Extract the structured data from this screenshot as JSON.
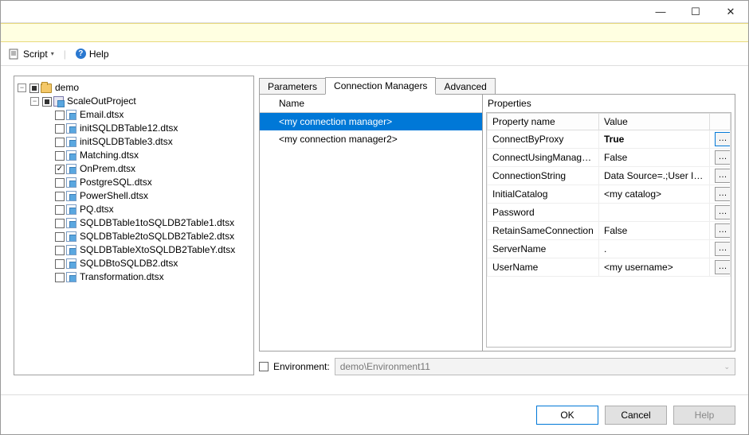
{
  "window": {
    "minimize_glyph": "—",
    "maximize_glyph": "☐",
    "close_glyph": "✕"
  },
  "toolbar": {
    "script_label": "Script",
    "help_label": "Help"
  },
  "tree": {
    "root": "demo",
    "project": "ScaleOutProject",
    "items": [
      "Email.dtsx",
      "initSQLDBTable12.dtsx",
      "initSQLDBTable3.dtsx",
      "Matching.dtsx",
      "OnPrem.dtsx",
      "PostgreSQL.dtsx",
      "PowerShell.dtsx",
      "PQ.dtsx",
      "SQLDBTable1toSQLDB2Table1.dtsx",
      "SQLDBTable2toSQLDB2Table2.dtsx",
      "SQLDBTableXtoSQLDB2TableY.dtsx",
      "SQLDBtoSQLDB2.dtsx",
      "Transformation.dtsx"
    ],
    "checked_index": 4
  },
  "tabs": {
    "parameters": "Parameters",
    "conn_mgrs": "Connection Managers",
    "advanced": "Advanced"
  },
  "cm": {
    "header": "Name",
    "items": [
      "<my connection manager>",
      "<my connection manager2>"
    ],
    "selected_index": 0
  },
  "props": {
    "title": "Properties",
    "col_name": "Property name",
    "col_value": "Value",
    "rows": [
      {
        "name": "ConnectByProxy",
        "value": "True",
        "bold": true,
        "btn_active": true
      },
      {
        "name": "ConnectUsingManagedIdentity",
        "value": "False"
      },
      {
        "name": "ConnectionString",
        "value": "Data Source=.;User ID=..."
      },
      {
        "name": "InitialCatalog",
        "value": "<my catalog>"
      },
      {
        "name": "Password",
        "value": ""
      },
      {
        "name": "RetainSameConnection",
        "value": "False"
      },
      {
        "name": "ServerName",
        "value": "."
      },
      {
        "name": "UserName",
        "value": "<my username>"
      }
    ]
  },
  "env": {
    "label": "Environment:",
    "value": "demo\\Environment11"
  },
  "footer": {
    "ok": "OK",
    "cancel": "Cancel",
    "help": "Help"
  }
}
